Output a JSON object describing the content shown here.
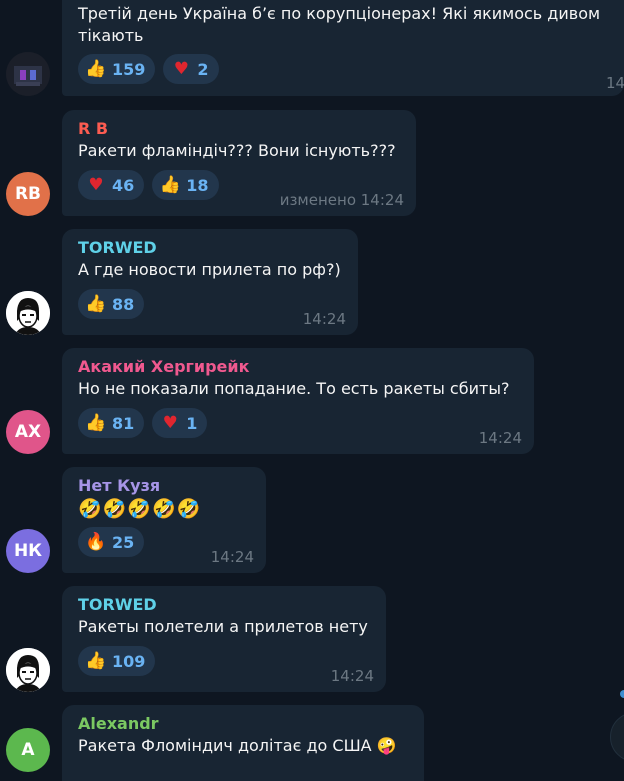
{
  "colors": {
    "background": "#0e1621",
    "bubble": "#182533",
    "reaction_bg": "#22364c",
    "reaction_count": "#6ab3f3",
    "timestamp": "#6c7883"
  },
  "messages": [
    {
      "author": "",
      "text_lines": [
        "Третій день Україна б’є по корупціонерах! Які якимось дивом",
        "тікають"
      ],
      "reactions": [
        {
          "icon": "thumbs-up-icon",
          "glyph": "👍",
          "count": "159"
        },
        {
          "icon": "heart-icon",
          "glyph": "♥",
          "count": "2"
        }
      ],
      "time": "14"
    },
    {
      "author": "R B",
      "author_color": "#fc5c51",
      "avatar_initials": "RB",
      "avatar_color": "#e17149",
      "text_lines": [
        "Ракети фламіндіч??? Вони існують???"
      ],
      "reactions": [
        {
          "icon": "heart-icon",
          "glyph": "♥",
          "count": "46"
        },
        {
          "icon": "thumbs-up-icon",
          "glyph": "👍",
          "count": "18"
        }
      ],
      "time": "изменено 14:24"
    },
    {
      "author": "TORWED",
      "author_color": "#5fd1e8",
      "text_lines": [
        "А где новости прилета по рф?)"
      ],
      "reactions": [
        {
          "icon": "thumbs-up-icon",
          "glyph": "👍",
          "count": "88"
        }
      ],
      "time": "14:24"
    },
    {
      "author": "Акакий Хергирейк",
      "author_color": "#f0598f",
      "avatar_initials": "АХ",
      "avatar_color": "#e0558a",
      "text_lines": [
        "Но не показали попадание. То есть ракеты сбиты?"
      ],
      "reactions": [
        {
          "icon": "thumbs-up-icon",
          "glyph": "👍",
          "count": "81"
        },
        {
          "icon": "heart-icon",
          "glyph": "♥",
          "count": "1"
        }
      ],
      "time": "14:24"
    },
    {
      "author": "Нет Кузя",
      "author_color": "#a695e7",
      "avatar_initials": "НК",
      "avatar_color": "#7b6ee0",
      "text_lines": [
        "🤣🤣🤣🤣🤣"
      ],
      "reactions": [
        {
          "icon": "fire-icon",
          "glyph": "🔥",
          "count": "25"
        }
      ],
      "time": "14:24"
    },
    {
      "author": "TORWED",
      "author_color": "#5fd1e8",
      "text_lines": [
        "Ракеты полетели а прилетов нету"
      ],
      "reactions": [
        {
          "icon": "thumbs-up-icon",
          "glyph": "👍",
          "count": "109"
        }
      ],
      "time": "14:24"
    },
    {
      "author": "Alexandr",
      "author_color": "#7bc862",
      "avatar_initials": "A",
      "avatar_color": "#5cb84e",
      "text_lines": [
        "Ракета Фломіндич долітає до США 🤪"
      ],
      "reactions": [],
      "time": ""
    }
  ]
}
